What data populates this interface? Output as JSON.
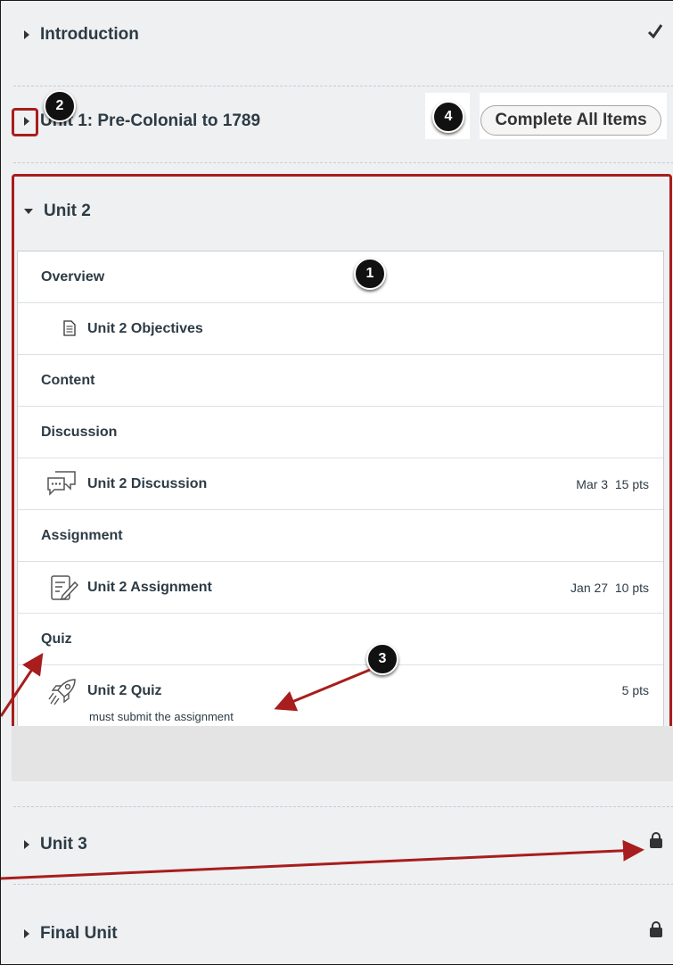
{
  "modules": {
    "intro": {
      "title": "Introduction",
      "status_icon": "checkmark-icon"
    },
    "unit1": {
      "title": "Unit 1: Pre-Colonial to 1789",
      "complete_label": "Complete All Items"
    },
    "unit2": {
      "title": "Unit 2"
    },
    "unit3": {
      "title": "Unit 3",
      "status_icon": "lock-icon"
    },
    "final": {
      "title": "Final Unit",
      "status_icon": "lock-icon"
    }
  },
  "unit2_items": {
    "overview": "Overview",
    "objectives": "Unit 2 Objectives",
    "content": "Content",
    "discussion_header": "Discussion",
    "discussion": {
      "label": "Unit 2 Discussion",
      "date": "Mar 3",
      "pts": "15 pts"
    },
    "assignment_header": "Assignment",
    "assignment": {
      "label": "Unit 2 Assignment",
      "date": "Jan 27",
      "pts": "10 pts"
    },
    "quiz_header": "Quiz",
    "quiz": {
      "label": "Unit 2 Quiz",
      "pts": "5 pts",
      "requirement": "must submit the assignment"
    }
  },
  "callouts": {
    "one": "1",
    "two": "2",
    "three": "3",
    "four": "4"
  },
  "colors": {
    "callout_red": "#a81d1d",
    "text": "#2d3b45",
    "background": "#eef0f2"
  }
}
